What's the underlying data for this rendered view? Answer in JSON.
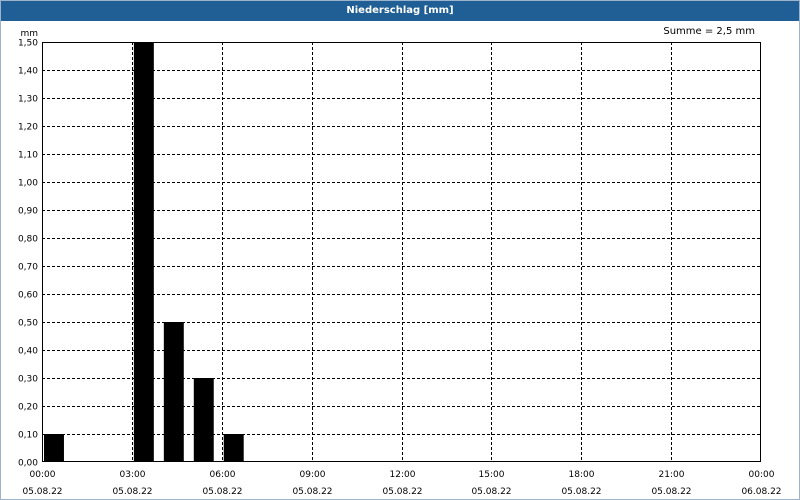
{
  "window": {
    "title": "Niederschlag [mm]"
  },
  "summary": "Summe = 2,5 mm",
  "colors": {
    "titlebar": "#1f5f95",
    "bars": "#000000",
    "grid": "#000000"
  },
  "chart_data": {
    "type": "bar",
    "title": "Niederschlag [mm]",
    "ylabel": "mm",
    "ylim": [
      0,
      1.5
    ],
    "y_ticks": [
      "0,00",
      "0,10",
      "0,20",
      "0,30",
      "0,40",
      "0,50",
      "0,60",
      "0,70",
      "0,80",
      "0,90",
      "1,00",
      "1,10",
      "1,20",
      "1,30",
      "1,40",
      "1,50"
    ],
    "x_ticks": [
      {
        "time": "00:00",
        "date": "05.08.22"
      },
      {
        "time": "03:00",
        "date": "05.08.22"
      },
      {
        "time": "06:00",
        "date": "05.08.22"
      },
      {
        "time": "09:00",
        "date": "05.08.22"
      },
      {
        "time": "12:00",
        "date": "05.08.22"
      },
      {
        "time": "15:00",
        "date": "05.08.22"
      },
      {
        "time": "18:00",
        "date": "05.08.22"
      },
      {
        "time": "21:00",
        "date": "05.08.22"
      },
      {
        "time": "00:00",
        "date": "06.08.22"
      }
    ],
    "xlim": [
      "05.08.22 00:00",
      "06.08.22 00:00"
    ],
    "grid": true,
    "bars": [
      {
        "start": "00:00",
        "end": "01:00",
        "value": 0.1
      },
      {
        "start": "03:00",
        "end": "04:00",
        "value": 1.5
      },
      {
        "start": "04:00",
        "end": "05:00",
        "value": 0.5
      },
      {
        "start": "05:00",
        "end": "06:00",
        "value": 0.3
      },
      {
        "start": "06:00",
        "end": "07:00",
        "value": 0.1
      }
    ]
  }
}
